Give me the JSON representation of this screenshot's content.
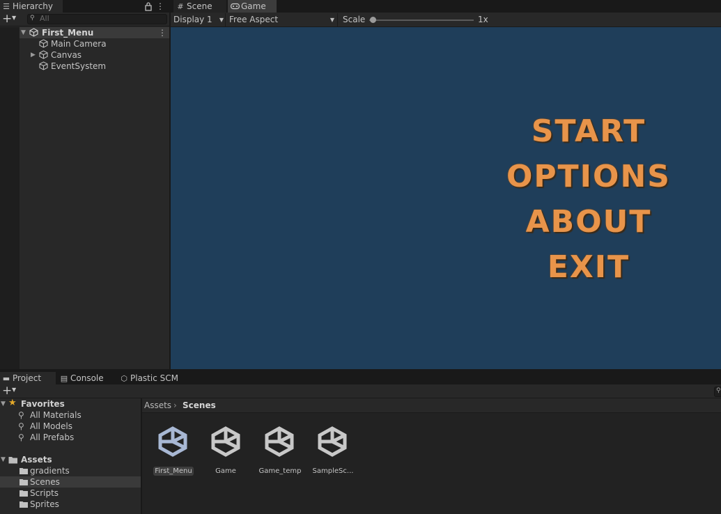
{
  "hierarchy": {
    "tab_label": "Hierarchy",
    "search_placeholder": "All",
    "scene_name": "First_Menu",
    "items": [
      {
        "label": "Main Camera"
      },
      {
        "label": "Canvas"
      },
      {
        "label": "EventSystem"
      }
    ]
  },
  "view_tabs": [
    {
      "label": "Scene",
      "icon": "grid-icon"
    },
    {
      "label": "Game",
      "icon": "gamepad-icon"
    }
  ],
  "game_toolbar": {
    "display": "Display 1",
    "aspect": "Free Aspect",
    "scale_label": "Scale",
    "scale_value": "1x",
    "scale_level": 0
  },
  "game_view": {
    "background": "#1f3e5a",
    "text_color": "#e8944a",
    "menu_items": [
      "START",
      "OPTIONS",
      "ABOUT",
      "EXIT"
    ]
  },
  "bottom_tabs": [
    {
      "label": "Project"
    },
    {
      "label": "Console"
    },
    {
      "label": "Plastic SCM"
    }
  ],
  "project": {
    "favorites_label": "Favorites",
    "favorites": [
      "All Materials",
      "All Models",
      "All Prefabs"
    ],
    "assets_label": "Assets",
    "folders": [
      "gradients",
      "Scenes",
      "Scripts",
      "Sprites"
    ],
    "selected_folder": "Scenes",
    "breadcrumb": {
      "root": "Assets",
      "current": "Scenes"
    },
    "scene_assets": [
      {
        "label": "First_Menu",
        "selected": true
      },
      {
        "label": "Game",
        "selected": false
      },
      {
        "label": "Game_temp",
        "selected": false
      },
      {
        "label": "SampleSc...",
        "selected": false
      }
    ]
  }
}
